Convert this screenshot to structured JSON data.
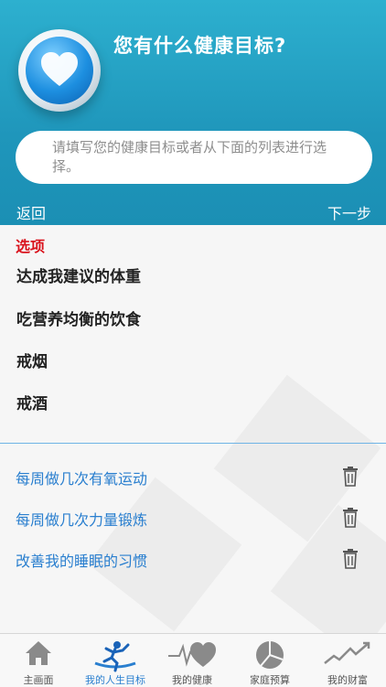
{
  "header": {
    "title": "您有什么健康目标?",
    "search_placeholder": "请填写您的健康目标或者从下面的列表进行选择。",
    "back_label": "返回",
    "next_label": "下一步",
    "colors": {
      "header_bg": "#1f96bb",
      "options_red": "#d9131d",
      "link_blue": "#2a7fcf"
    }
  },
  "options": {
    "title": "选项",
    "items": [
      "达成我建议的体重",
      "吃营养均衡的饮食",
      "戒烟",
      "戒酒"
    ]
  },
  "goals": {
    "items": [
      "每周做几次有氧运动",
      "每周做几次力量锻炼",
      "改善我的睡眠的习惯"
    ],
    "delete_icon": "trash-icon"
  },
  "tabbar": {
    "tabs": [
      {
        "label": "主画面",
        "icon": "home-icon"
      },
      {
        "label": "我的人生目标",
        "icon": "runner-icon"
      },
      {
        "label": "我的健康",
        "icon": "heart-pulse-icon"
      },
      {
        "label": "家庭预算",
        "icon": "pie-chart-icon"
      },
      {
        "label": "我的财富",
        "icon": "trend-line-icon"
      }
    ],
    "active_index": 1
  }
}
